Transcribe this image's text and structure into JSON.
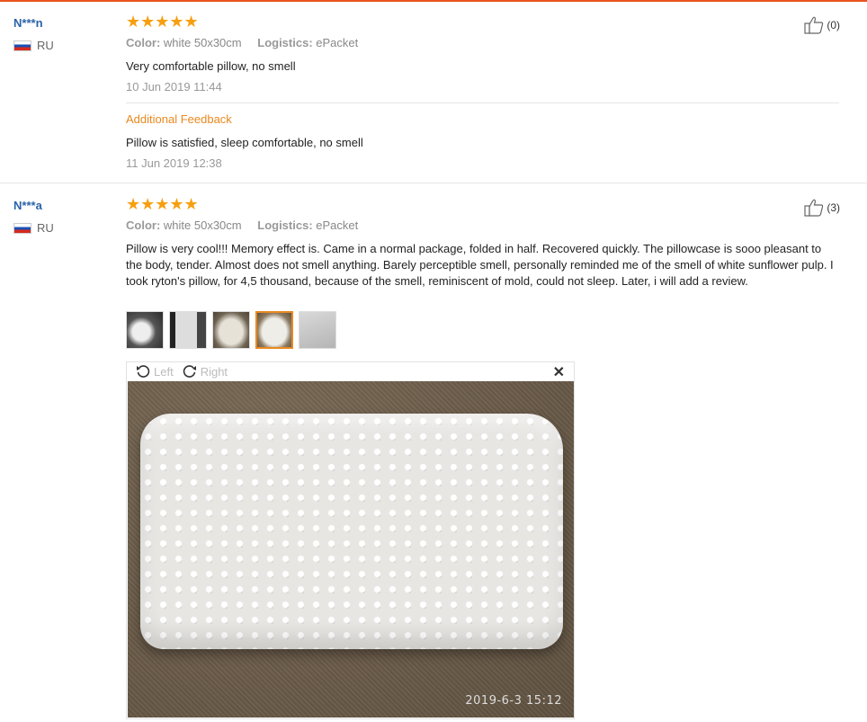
{
  "reviews": [
    {
      "user": "N***n",
      "country": "RU",
      "stars": "★★★★★",
      "color_label": "Color:",
      "color_value": "white 50x30cm",
      "logistics_label": "Logistics:",
      "logistics_value": "ePacket",
      "text": "Very comfortable pillow, no smell",
      "date": "10 Jun 2019 11:44",
      "additional_feedback_label": "Additional Feedback",
      "additional_text": "Pillow is satisfied, sleep comfortable, no smell",
      "additional_date": "11 Jun 2019 12:38",
      "helpful_count": "(0)"
    },
    {
      "user": "N***a",
      "country": "RU",
      "stars": "★★★★★",
      "color_label": "Color:",
      "color_value": "white 50x30cm",
      "logistics_label": "Logistics:",
      "logistics_value": "ePacket",
      "text": "Pillow is very cool!!! Memory effect is. Came in a normal package, folded in half. Recovered quickly. The pillowcase is sooo pleasant to the body, tender. Almost does not smell anything. Barely perceptible smell, personally reminded me of the smell of white sunflower pulp. I took ryton's pillow, for 4,5 thousand, because of the smell, reminiscent of mold, could not sleep. Later, i will add a review.",
      "helpful_count": "(3)",
      "photo_count": 5,
      "active_photo": 4
    }
  ],
  "viewer": {
    "rotate_left": "Left",
    "rotate_right": "Right",
    "photo_timestamp": "2019-6-3 15:12"
  },
  "colors": {
    "accent": "#e9891f",
    "username": "#2a63a9",
    "star": "#f79f0f"
  }
}
